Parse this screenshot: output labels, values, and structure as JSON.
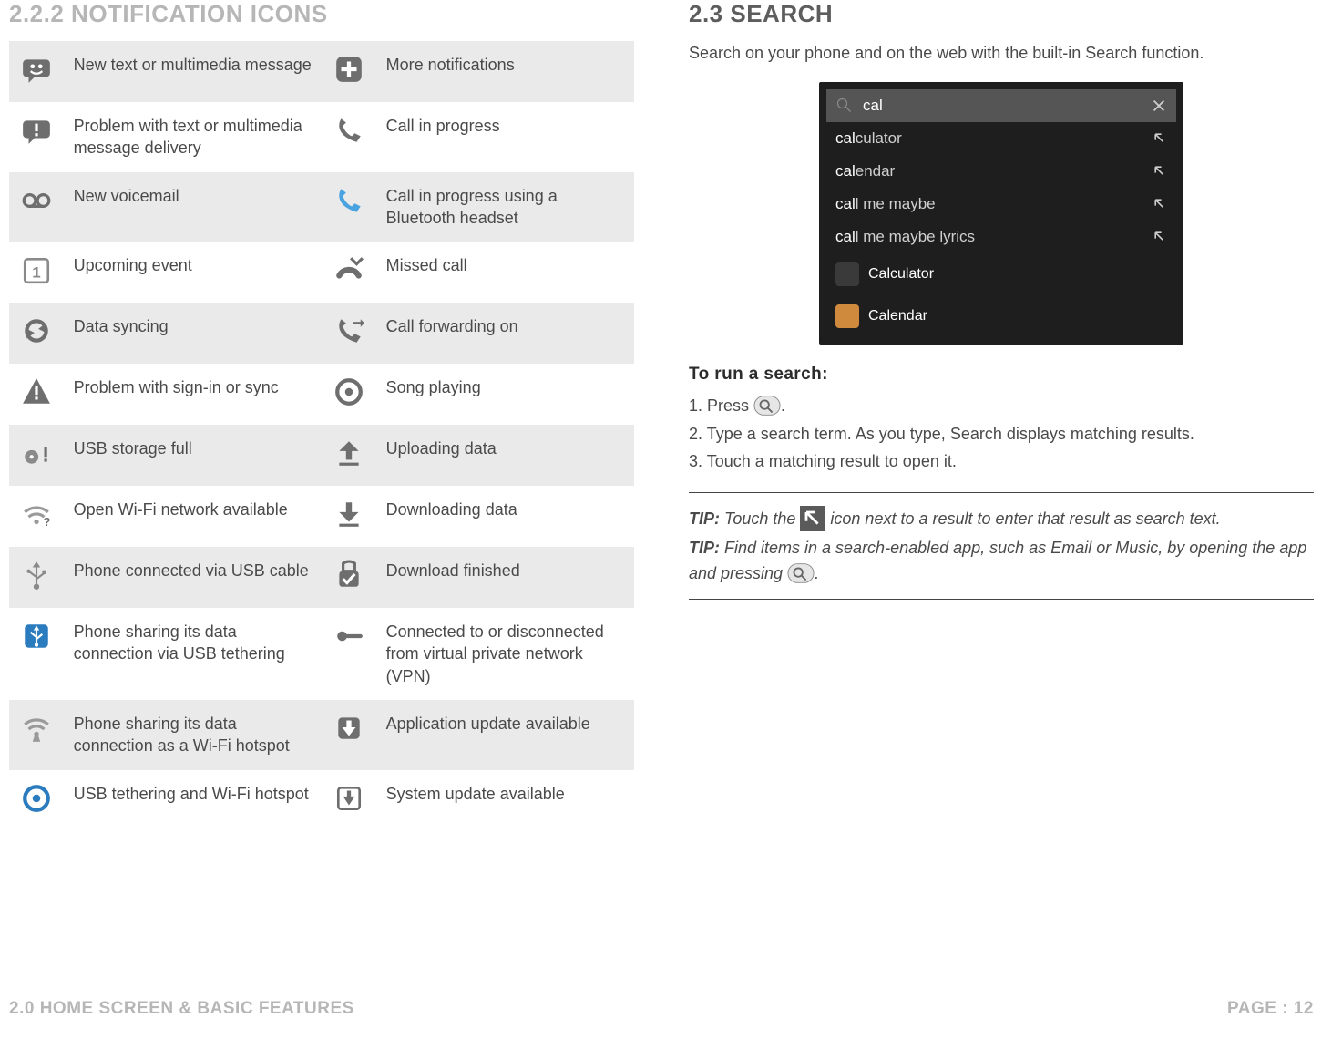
{
  "left": {
    "heading": "2.2.2 NOTIFICATION ICONS",
    "rows": [
      {
        "a": "New text or multimedia message",
        "b": "More notifications"
      },
      {
        "a": "Problem with text or multimedia message delivery",
        "b": "Call in progress"
      },
      {
        "a": "New voicemail",
        "b": "Call in progress using a Bluetooth headset"
      },
      {
        "a": "Upcoming event",
        "b": "Missed call"
      },
      {
        "a": "Data syncing",
        "b": "Call forwarding on"
      },
      {
        "a": "Problem with sign-in or sync",
        "b": "Song playing"
      },
      {
        "a": "USB storage full",
        "b": "Uploading data"
      },
      {
        "a": "Open Wi-Fi network available",
        "b": "Downloading data"
      },
      {
        "a": "Phone connected via USB cable",
        "b": "Download finished"
      },
      {
        "a": "Phone sharing its data connection via USB tethering",
        "b": "Connected to or disconnected from virtual private network (VPN)"
      },
      {
        "a": "Phone sharing its data connection as a Wi-Fi hotspot",
        "b": "Application update available"
      },
      {
        "a": "USB tethering and Wi-Fi hotspot",
        "b": "System update available"
      }
    ]
  },
  "right": {
    "heading": "2.3 SEARCH",
    "intro": "Search on your phone and on the web with the built-in Search function.",
    "screenshot": {
      "query": "cal",
      "suggestions": [
        {
          "prefix": "cal",
          "rest": "culator"
        },
        {
          "prefix": "cal",
          "rest": "endar"
        },
        {
          "prefix": "cal",
          "rest": "l me maybe"
        },
        {
          "prefix": "cal",
          "rest": "l me maybe lyrics"
        }
      ],
      "apps": [
        "Calculator",
        "Calendar"
      ]
    },
    "sub": "To run a search:",
    "steps": [
      "1. Press ",
      "2. Type a search term. As you type, Search displays matching results.",
      "3. Touch a matching result to open it."
    ],
    "step1_after": ".",
    "tip1_pre": "TIP:",
    "tip1": " Touch the ",
    "tip1_after": " icon next to a result to enter that result as search text.",
    "tip2_pre": "TIP:",
    "tip2": " Find items in a search-enabled app, such as Email or Music, by opening the app and pressing ",
    "tip2_after": "."
  },
  "footer": {
    "left": "2.0 HOME SCREEN & BASIC FEATURES",
    "right": "PAGE : 12"
  }
}
